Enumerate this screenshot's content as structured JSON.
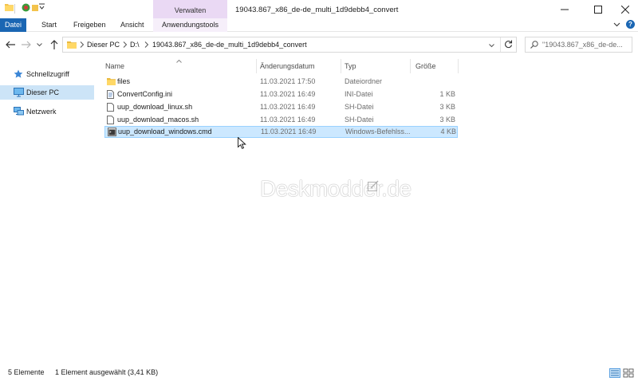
{
  "window": {
    "title": "19043.867_x86_de-de_multi_1d9debb4_convert",
    "contextual_tab": "Verwalten"
  },
  "ribbon": {
    "tabs": [
      "Datei",
      "Start",
      "Freigeben",
      "Ansicht",
      "Anwendungstools"
    ],
    "active_file_color": "#1a66b3",
    "help_label": "?"
  },
  "address": {
    "crumbs": [
      "Dieser PC",
      "D:\\",
      "19043.867_x86_de-de_multi_1d9debb4_convert"
    ]
  },
  "search": {
    "text": "\"19043.867_x86_de-de..."
  },
  "sidebar": {
    "items": [
      {
        "label": "Schnellzugriff",
        "icon": "star-icon"
      },
      {
        "label": "Dieser PC",
        "icon": "monitor-icon"
      },
      {
        "label": "Netzwerk",
        "icon": "network-icon"
      }
    ]
  },
  "columns": [
    "Name",
    "Änderungsdatum",
    "Typ",
    "Größe"
  ],
  "files": [
    {
      "name": "files",
      "date": "11.03.2021 17:50",
      "type": "Dateiordner",
      "size": "",
      "icon": "folder-icon"
    },
    {
      "name": "ConvertConfig.ini",
      "date": "11.03.2021 16:49",
      "type": "INI-Datei",
      "size": "1 KB",
      "icon": "ini-file-icon"
    },
    {
      "name": "uup_download_linux.sh",
      "date": "11.03.2021 16:49",
      "type": "SH-Datei",
      "size": "3 KB",
      "icon": "file-icon"
    },
    {
      "name": "uup_download_macos.sh",
      "date": "11.03.2021 16:49",
      "type": "SH-Datei",
      "size": "3 KB",
      "icon": "file-icon"
    },
    {
      "name": "uup_download_windows.cmd",
      "date": "11.03.2021 16:49",
      "type": "Windows-Befehlss...",
      "size": "4 KB",
      "icon": "cmd-file-icon",
      "selected": true
    }
  ],
  "watermark": "Deskmodder.de",
  "status": {
    "count": "5 Elemente",
    "selection": "1 Element ausgewählt (3,41 KB)"
  },
  "colors": {
    "selection_bg": "#cce8ff",
    "selection_border": "#99d1ff",
    "contextual_tab_bg": "#ead9f4"
  }
}
